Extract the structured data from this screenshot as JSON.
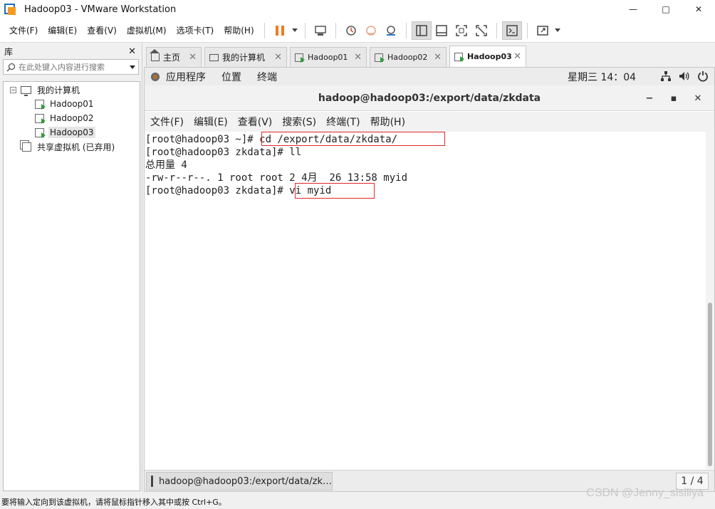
{
  "window": {
    "title": "Hadoop03 - VMware Workstation",
    "min": "—",
    "max": "□",
    "close": "✕"
  },
  "menubar": {
    "items": [
      "文件(F)",
      "编辑(E)",
      "查看(V)",
      "虚拟机(M)",
      "选项卡(T)",
      "帮助(H)"
    ]
  },
  "library": {
    "title": "库",
    "close": "✕",
    "search_placeholder": "在此处键入内容进行搜索",
    "tree": {
      "root": "我的计算机",
      "expander": "−",
      "vms": [
        "Hadoop01",
        "Hadoop02",
        "Hadoop03"
      ],
      "shared": "共享虚拟机 (已弃用)"
    }
  },
  "tabs": [
    {
      "label": "主页",
      "close": "✕"
    },
    {
      "label": "我的计算机",
      "close": "✕"
    },
    {
      "label": "Hadoop01",
      "close": "✕"
    },
    {
      "label": "Hadoop02",
      "close": "✕"
    },
    {
      "label": "Hadoop03",
      "close": "✕"
    }
  ],
  "guest": {
    "topbar": {
      "apps": "应用程序",
      "places": "位置",
      "terminal": "终端",
      "clock": "星期三 14：04"
    },
    "terminal_window": {
      "title": "hadoop@hadoop03:/export/data/zkdata",
      "min": "−",
      "max": "▪",
      "close": "✕",
      "menu": [
        "文件(F)",
        "编辑(E)",
        "查看(V)",
        "搜索(S)",
        "终端(T)",
        "帮助(H)"
      ],
      "lines": [
        "[root@hadoop03 ~]# cd /export/data/zkdata/",
        "[root@hadoop03 zkdata]# ll",
        "总用量 4",
        "-rw-r--r--. 1 root root 2 4月  26 13:58 myid",
        "[root@hadoop03 zkdata]# vi myid"
      ]
    },
    "taskbar": {
      "task_label": "hadoop@hadoop03:/export/data/zk…",
      "pager": "1 / 4"
    }
  },
  "statusbar": {
    "text": "要将输入定向到该虚拟机，请将鼠标指针移入其中或按 Ctrl+G。"
  },
  "watermark": "CSDN @Jenny_sisiliya"
}
